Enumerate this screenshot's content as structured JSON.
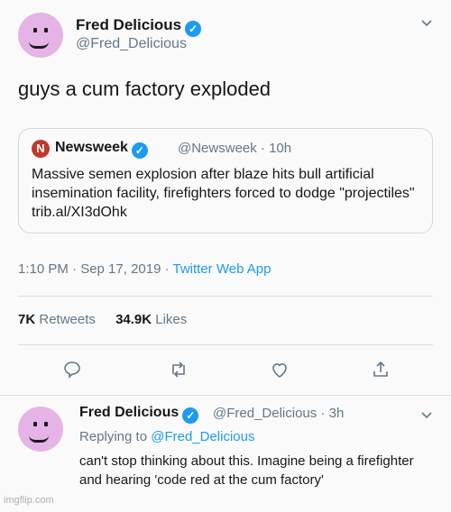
{
  "tweet": {
    "author_name": "Fred Delicious",
    "author_handle": "@Fred_Delicious",
    "text": "guys a cum factory exploded",
    "quote": {
      "logo_letter": "N",
      "source_name": "Newsweek",
      "source_handle": "@Newsweek · 10h",
      "text": "Massive semen explosion after blaze hits bull artificial insemination facility, firefighters forced to dodge \"projectiles\" trib.al/XI3dOhk"
    },
    "timestamp": "1:10 PM · Sep 17, 2019 · ",
    "client": "Twitter Web App",
    "retweets_count": "7K",
    "retweets_label": " Retweets",
    "likes_count": "34.9K",
    "likes_label": " Likes"
  },
  "reply": {
    "author_name": "Fred Delicious",
    "author_handle": "@Fred_Delicious · 3h",
    "replying_prefix": "Replying to ",
    "replying_to": "@Fred_Delicious",
    "text": "can't stop thinking about this. Imagine being a firefighter and hearing 'code red at the cum factory'"
  },
  "watermark": "imgflip.com",
  "colors": {
    "link": "#1d9bf0",
    "avatar": "#e6b3e6",
    "newsweek": "#c0392b"
  },
  "icons": [
    "verified-badge-icon",
    "chevron-down-icon",
    "reply-icon",
    "retweet-icon",
    "like-icon",
    "share-icon"
  ]
}
